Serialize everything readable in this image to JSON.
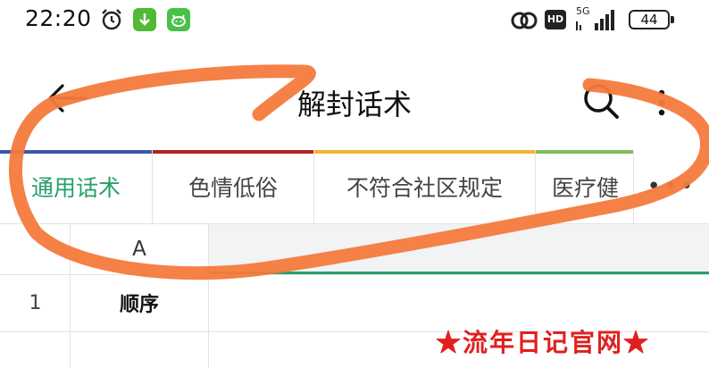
{
  "status_bar": {
    "time": "22:20",
    "network": "5G",
    "hd": "HD",
    "battery": "44"
  },
  "header": {
    "title": "解封话术"
  },
  "tabs": [
    {
      "label": "通用话术",
      "color": "#3a57a8",
      "active": true
    },
    {
      "label": "色情低俗",
      "color": "#b22222",
      "active": false
    },
    {
      "label": "不符合社区规定",
      "color": "#f2b632",
      "active": false
    },
    {
      "label": "医疗健",
      "color": "#7fbf5a",
      "active": false
    }
  ],
  "tabs_more": "•••",
  "sheet": {
    "column_header": "A",
    "rows": [
      {
        "number": "1",
        "cell_a": "顺序"
      }
    ]
  },
  "annotation": {
    "color": "#f47a3c"
  },
  "watermark": "★流年日记官网★"
}
